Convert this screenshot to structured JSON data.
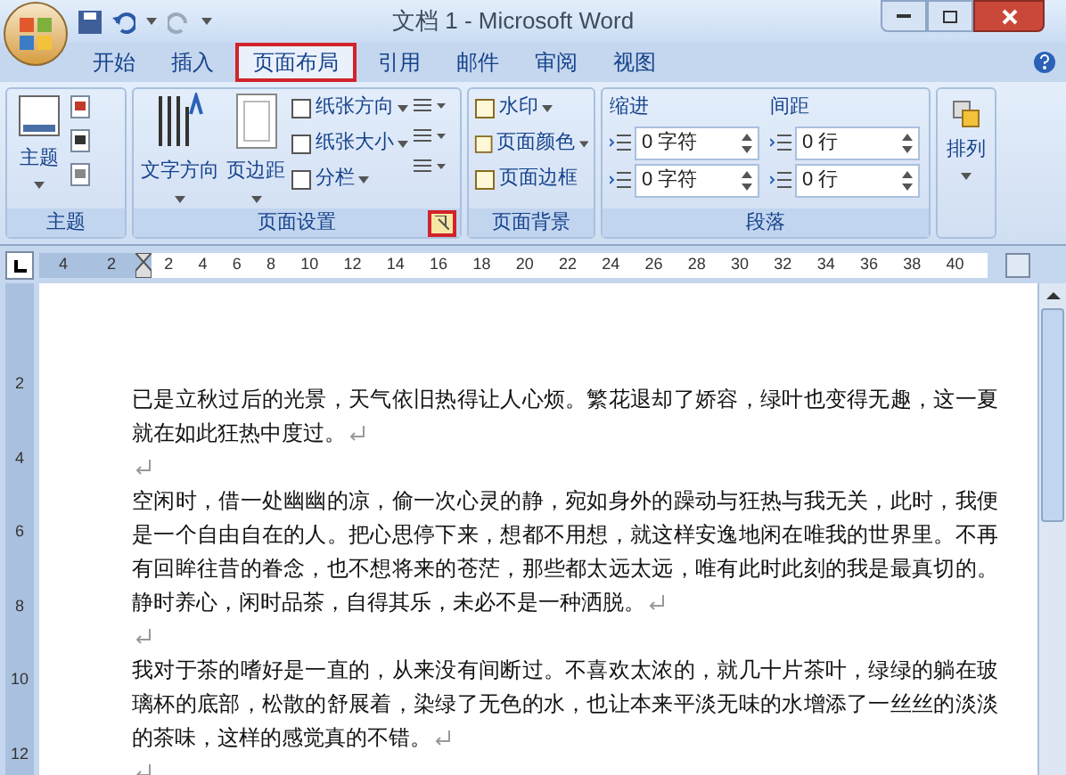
{
  "window": {
    "title": "文档 1 - Microsoft Word"
  },
  "tabs": [
    {
      "label": "开始",
      "selected": false
    },
    {
      "label": "插入",
      "selected": false
    },
    {
      "label": "页面布局",
      "selected": true
    },
    {
      "label": "引用",
      "selected": false
    },
    {
      "label": "邮件",
      "selected": false
    },
    {
      "label": "审阅",
      "selected": false
    },
    {
      "label": "视图",
      "selected": false
    }
  ],
  "theme_group": {
    "label": "主题",
    "button": "主题"
  },
  "page_setup_group": {
    "label": "页面设置",
    "large_buttons": [
      "文字方向",
      "页边距"
    ],
    "menu_items": [
      "纸张方向",
      "纸张大小",
      "分栏"
    ],
    "launcher_highlighted": true
  },
  "background_group": {
    "label": "页面背景",
    "items": [
      "水印",
      "页面颜色",
      "页面边框"
    ]
  },
  "paragraph_group": {
    "label": "段落",
    "indent": {
      "label": "缩进",
      "fields": [
        {
          "value": "0 字符"
        },
        {
          "value": "0 字符"
        }
      ]
    },
    "spacing": {
      "label": "间距",
      "fields": [
        {
          "value": "0 行"
        },
        {
          "value": "0 行"
        }
      ]
    }
  },
  "arrange_group": {
    "button": "排列"
  },
  "ruler": {
    "left_ticks": [
      "4",
      "2"
    ],
    "ticks": [
      "2",
      "4",
      "6",
      "8",
      "10",
      "12",
      "14",
      "16",
      "18",
      "20",
      "22",
      "24",
      "26",
      "28",
      "30",
      "32",
      "34",
      "36",
      "38",
      "40"
    ]
  },
  "vertical_ruler": {
    "ticks": [
      "2",
      "4",
      "6",
      "8",
      "10",
      "12"
    ]
  },
  "document": {
    "paragraphs": [
      {
        "kind": "text",
        "text": "已是立秋过后的光景，天气依旧热得让人心烦。繁花退却了娇容，绿叶也变得无趣，这一夏就在如此狂热中度过。"
      },
      {
        "kind": "empty"
      },
      {
        "kind": "text",
        "text": "空闲时，借一处幽幽的凉，偷一次心灵的静，宛如身外的躁动与狂热与我无关，此时，我便是一个自由自在的人。把心思停下来，想都不用想，就这样安逸地闲在唯我的世界里。不再有回眸往昔的眷念，也不想将来的苍茫，那些都太远太远，唯有此时此刻的我是最真切的。静时养心，闲时品茶，自得其乐，未必不是一种洒脱。"
      },
      {
        "kind": "empty"
      },
      {
        "kind": "text",
        "text": "我对于茶的嗜好是一直的，从来没有间断过。不喜欢太浓的，就几十片茶叶，绿绿的躺在玻璃杯的底部，松散的舒展着，染绿了无色的水，也让本来平淡无味的水增添了一丝丝的淡淡的茶味，这样的感觉真的不错。"
      },
      {
        "kind": "empty"
      }
    ]
  }
}
